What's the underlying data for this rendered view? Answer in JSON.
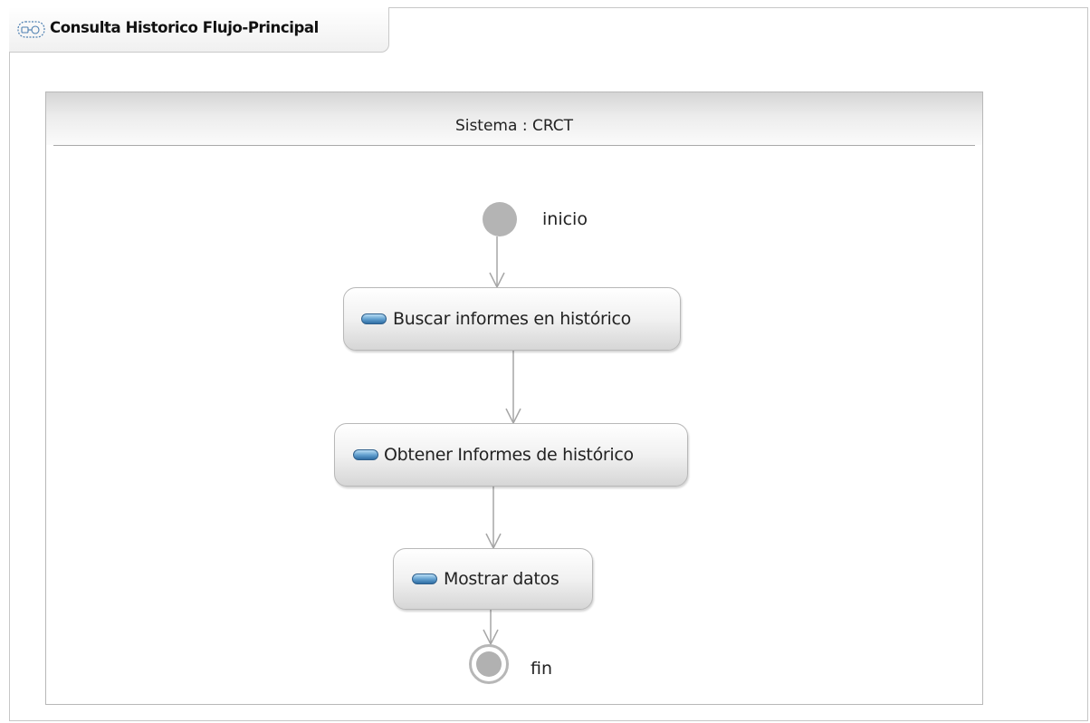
{
  "diagram": {
    "title": "Consulta Historico Flujo-Principal",
    "title_icon": "activity-diagram-icon",
    "partition": {
      "name": "Sistema : CRCT"
    },
    "initial_node": {
      "label": "inicio"
    },
    "actions": [
      {
        "label": "Buscar informes en histórico",
        "icon": "action-icon"
      },
      {
        "label": "Obtener Informes de histórico",
        "icon": "action-icon"
      },
      {
        "label": "Mostrar datos",
        "icon": "action-icon"
      }
    ],
    "final_node": {
      "label": "fin"
    }
  }
}
